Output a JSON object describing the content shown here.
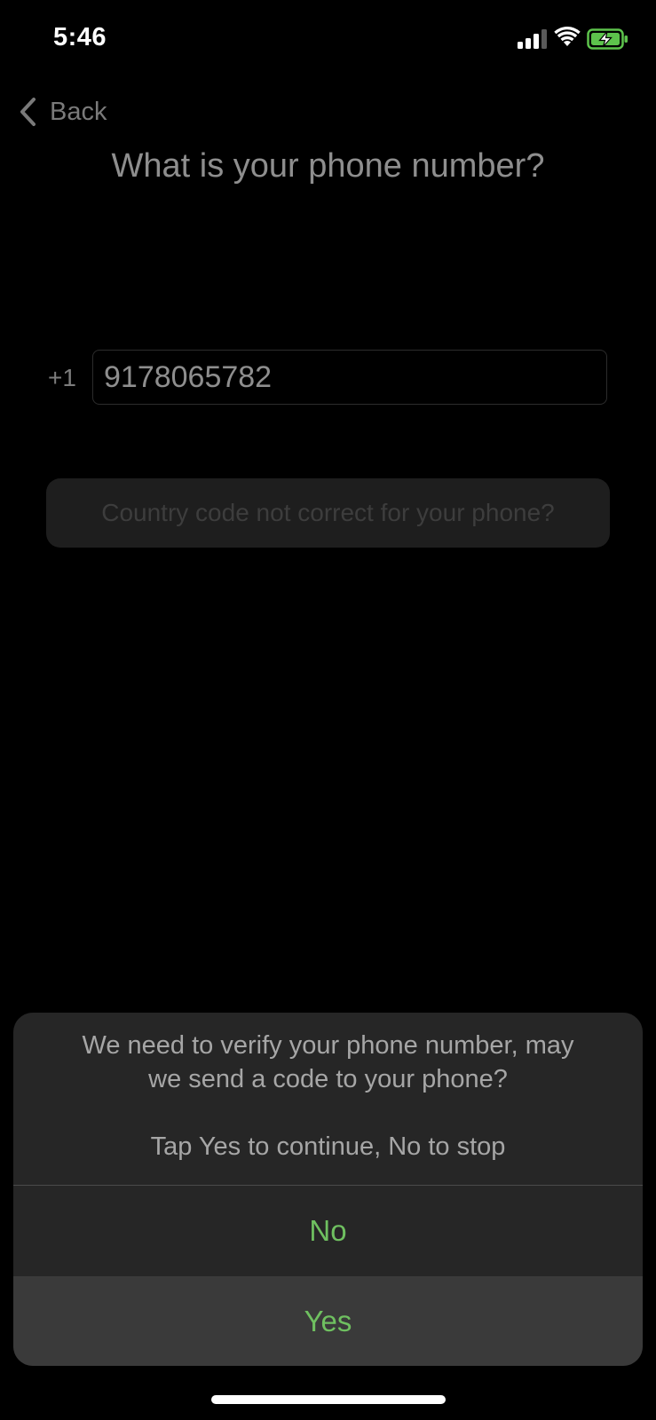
{
  "status_bar": {
    "time": "5:46",
    "signal_icon": "cellular-signal-icon",
    "wifi_icon": "wifi-icon",
    "battery_icon": "battery-charging-icon",
    "battery_color": "#5dc34c",
    "signal_bars_filled": 3,
    "signal_bars_total": 4
  },
  "nav": {
    "back_label": "Back",
    "back_icon": "chevron-left-icon"
  },
  "page": {
    "title": "What is your phone number?",
    "country_code": "+1",
    "phone_value": "9178065782",
    "country_button_label": "Country code not correct for your phone?"
  },
  "sheet": {
    "message_line_1": "We need to verify your phone number, may",
    "message_line_2": "we send a code to your phone?",
    "message_line_3": "Tap Yes to continue, No to stop",
    "no_label": "No",
    "yes_label": "Yes",
    "accent_color": "#6fc060"
  }
}
